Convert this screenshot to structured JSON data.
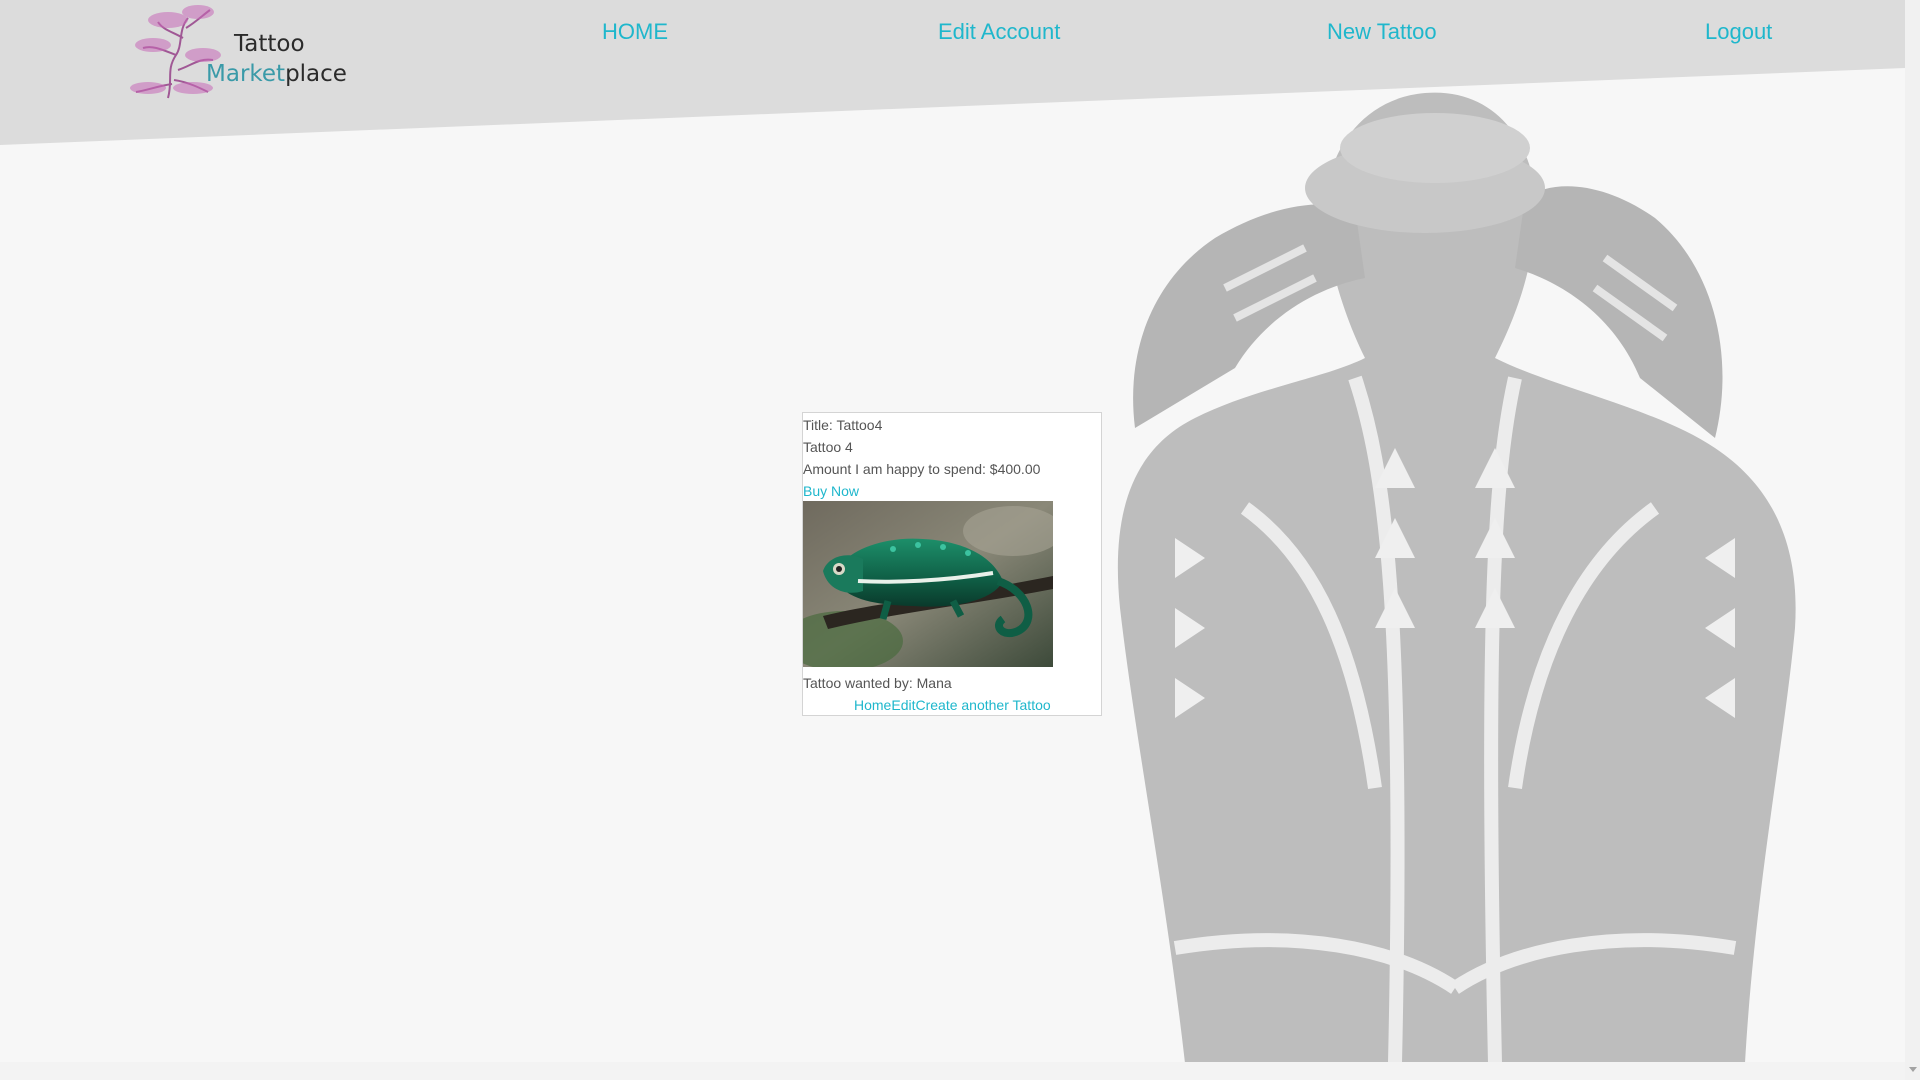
{
  "app": {
    "logo_line1": "Tattoo",
    "logo_line2_a": "Market",
    "logo_line2_b": "place"
  },
  "nav": {
    "home": "HOME",
    "edit_account": "Edit Account",
    "new_tattoo": "New Tattoo",
    "logout": "Logout"
  },
  "colors": {
    "link": "#1fb7cc",
    "header_bg": "#dcdcdc",
    "page_bg": "#f7f7f7",
    "text": "#555555"
  },
  "card": {
    "title": "Title: Tattoo4",
    "description": "Tattoo 4",
    "amount": "Amount I am happy to spend: $400.00",
    "buy_now": "Buy Now",
    "image_subject": "chameleon-on-branch",
    "wanted_by": "Tattoo wanted by: Mana",
    "link_home": "Home",
    "link_edit": "Edit",
    "link_create": "Create another Tattoo"
  }
}
